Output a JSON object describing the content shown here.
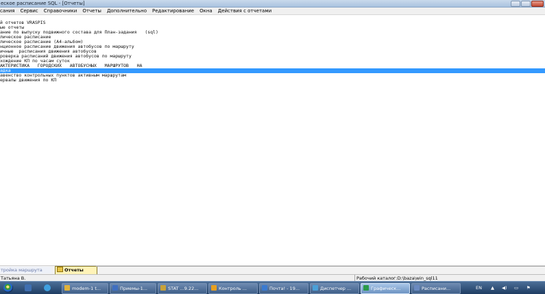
{
  "window": {
    "title": "еское расписание SQL - [Отчеты]"
  },
  "menu": [
    "сания",
    "Сервис",
    "Справочники",
    "Отчеты",
    "Дополнительно",
    "Редактирование",
    "Окна",
    "Действия с отчетами"
  ],
  "reports": [
    {
      "label": "й отчетов VRASPIS",
      "selected": false
    },
    {
      "label": "ые отчеты",
      "selected": false
    },
    {
      "label": "ание по выпуску подвижного состава для План-задания   (sql)",
      "selected": false
    },
    {
      "label": "лическое расписание",
      "selected": false
    },
    {
      "label": "лическое расписание (А4-альбом)",
      "selected": false
    },
    {
      "label": "нционное расписание движения автобусов по маршруту",
      "selected": false
    },
    {
      "label": "ичные  расписания движения автобусов",
      "selected": false
    },
    {
      "label": "роверка расписаний движения автобусов по маршруту",
      "selected": false
    },
    {
      "label": "хождение КП по часам суток",
      "selected": false
    },
    {
      "label": "АКТЕРИСТИКА   ГОРОДСКИХ   АВТОБУСНЫХ   МАРШРУТОВ   НА",
      "selected": false
    },
    {
      "label": "адка",
      "selected": true
    },
    {
      "label": "авенство контрольных пунктов активным маршрутам",
      "selected": false
    },
    {
      "label": "ервалы движения по КП",
      "selected": false
    }
  ],
  "bottom_tabs": {
    "inactive": "тройка маршрута",
    "active": "Отчеты"
  },
  "status": {
    "user": "Татьяна В.",
    "catalog": "Рабочий каталог:D:\\baza\\win_sql11"
  },
  "taskbar": {
    "buttons": [
      {
        "label": "modem-1 t...",
        "color": "#e0b23a",
        "active": false
      },
      {
        "label": "Приемы-1...",
        "color": "#3f6fc0",
        "active": false
      },
      {
        "label": "STAT ...9.22...",
        "color": "#c8a23a",
        "active": false
      },
      {
        "label": "Контроль ...",
        "color": "#e8a020",
        "active": false
      },
      {
        "label": "Почта! - 19...",
        "color": "#3a7ad0",
        "active": false
      },
      {
        "label": "Диспетчер ...",
        "color": "#4aa0d8",
        "active": false
      },
      {
        "label": "Графическ...",
        "color": "#2a9a4a",
        "active": true
      },
      {
        "label": "Расписани...",
        "color": "#6a8ac0",
        "active": false
      }
    ],
    "tray": {
      "lang": "EN"
    }
  },
  "colors": {
    "selection": "#3399ff",
    "taskbar": "#2b4a74"
  }
}
